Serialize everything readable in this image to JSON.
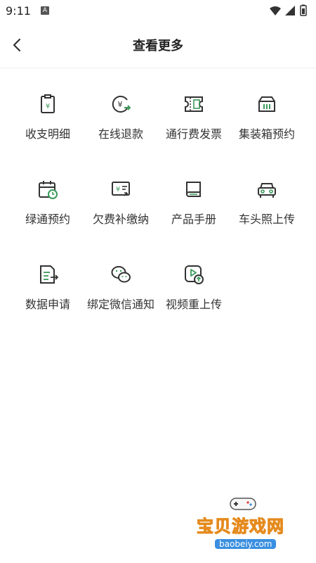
{
  "status_bar": {
    "time": "9:11",
    "notification_icon": "A"
  },
  "header": {
    "title": "查看更多"
  },
  "accent_color": "#3a9a5a",
  "items": [
    {
      "label": "收支明细",
      "icon": "clipboard-yen-icon"
    },
    {
      "label": "在线退款",
      "icon": "yen-refund-icon"
    },
    {
      "label": "通行费发票",
      "icon": "toll-invoice-icon"
    },
    {
      "label": "集装箱预约",
      "icon": "container-icon"
    },
    {
      "label": "绿通预约",
      "icon": "calendar-clock-icon"
    },
    {
      "label": "欠费补缴纳",
      "icon": "arrears-payment-icon"
    },
    {
      "label": "产品手册",
      "icon": "book-icon"
    },
    {
      "label": "车头照上传",
      "icon": "car-front-icon"
    },
    {
      "label": "数据申请",
      "icon": "document-arrow-icon"
    },
    {
      "label": "绑定微信通知",
      "icon": "wechat-icon"
    },
    {
      "label": "视频重上传",
      "icon": "video-upload-icon"
    }
  ],
  "watermark": {
    "text": "宝贝游戏网",
    "url": "baobeiy.com"
  }
}
